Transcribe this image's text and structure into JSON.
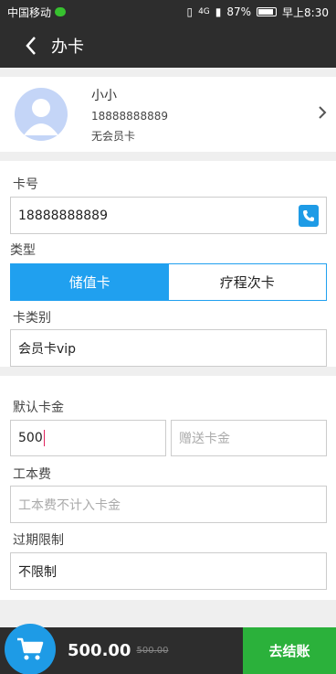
{
  "status_bar": {
    "carrier": "中国移动",
    "network": "4G",
    "battery": "87%",
    "time": "早上8:30"
  },
  "header": {
    "title": "办卡"
  },
  "member": {
    "name": "小小",
    "phone": "18888888889",
    "level": "无会员卡"
  },
  "card_form": {
    "card_no_label": "卡号",
    "card_no_value": "18888888889",
    "type_label": "类型",
    "tabs": [
      {
        "label": "储值卡",
        "active": true
      },
      {
        "label": "疗程次卡",
        "active": false
      }
    ],
    "category_label": "卡类别",
    "category_value": "会员卡vip"
  },
  "amount_form": {
    "default_amount_label": "默认卡金",
    "default_amount_value": "500",
    "gift_placeholder": "赠送卡金",
    "fee_label": "工本费",
    "fee_placeholder": "工本费不计入卡金",
    "expiry_label": "过期限制",
    "expiry_value": "不限制"
  },
  "bottom_bar": {
    "total": "500.00",
    "original": "500.00",
    "checkout_label": "去结账"
  },
  "colors": {
    "accent": "#20a0ef",
    "checkout": "#2bb13b",
    "dark": "#2d2d2d"
  }
}
